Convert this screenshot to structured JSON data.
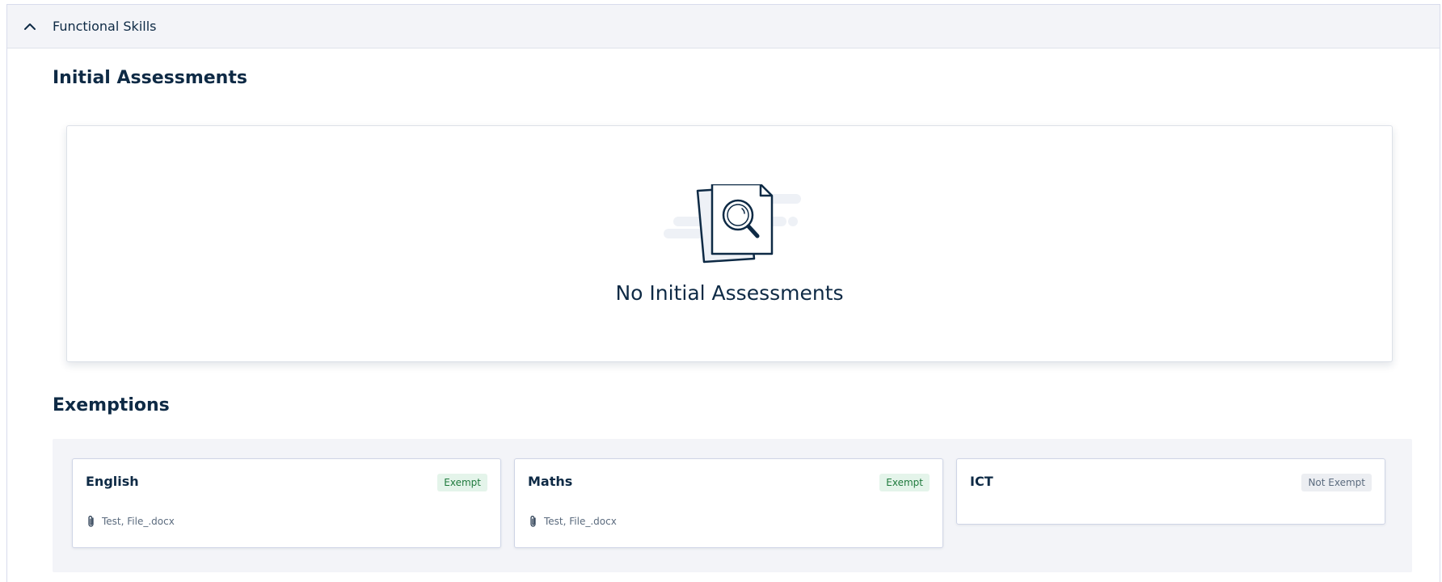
{
  "accordion": {
    "title": "Functional Skills"
  },
  "initial_assessments": {
    "title": "Initial Assessments",
    "empty_message": "No Initial Assessments"
  },
  "exemptions": {
    "title": "Exemptions",
    "items": [
      {
        "subject": "English",
        "status": "Exempt",
        "attachment": "Test, File_.docx"
      },
      {
        "subject": "Maths",
        "status": "Exempt",
        "attachment": "Test, File_.docx"
      },
      {
        "subject": "ICT",
        "status": "Not Exempt",
        "attachment": ""
      }
    ]
  },
  "colors": {
    "text_primary": "#0e2a45",
    "exempt_badge_bg": "#e4f4ea",
    "exempt_badge_text": "#1f7a3d",
    "not_exempt_badge_bg": "#eceef2",
    "panel_bg": "#f3f4f8"
  },
  "icons": {
    "collapse": "chevron-up-icon",
    "empty_state": "document-search-icon",
    "attachment": "paperclip-icon"
  }
}
